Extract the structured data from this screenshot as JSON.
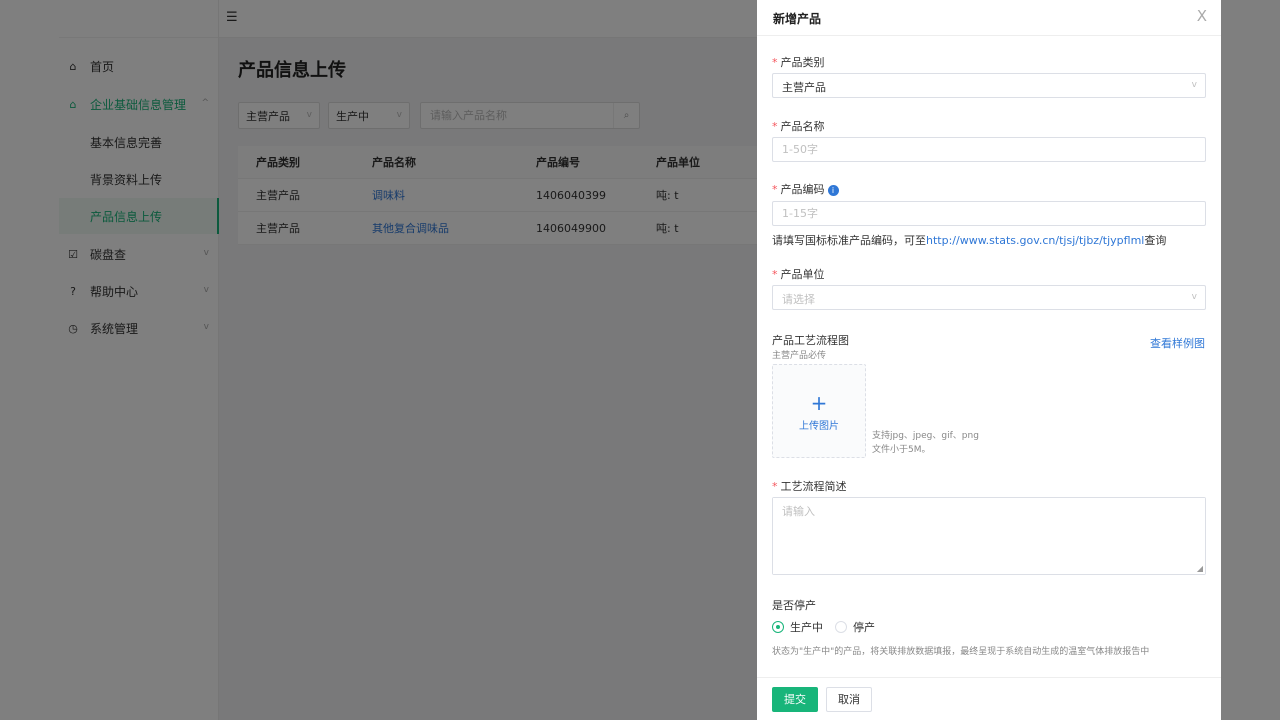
{
  "sidebar": {
    "items": [
      {
        "label": "首页",
        "icon": "home-icon"
      },
      {
        "label": "企业基础信息管理",
        "icon": "building-icon"
      },
      {
        "label": "碳盘查",
        "icon": "checklist-icon"
      },
      {
        "label": "帮助中心",
        "icon": "help-icon"
      },
      {
        "label": "系统管理",
        "icon": "settings-icon"
      }
    ],
    "subitems": [
      {
        "label": "基本信息完善"
      },
      {
        "label": "背景资料上传"
      },
      {
        "label": "产品信息上传"
      }
    ]
  },
  "page": {
    "title": "产品信息上传",
    "filters": {
      "category": "主营产品",
      "status": "生产中",
      "search_placeholder": "请输入产品名称"
    },
    "table": {
      "columns": [
        "产品类别",
        "产品名称",
        "产品编号",
        "产品单位"
      ],
      "rows": [
        [
          "主营产品",
          "调味料",
          "1406040399",
          "吨: t"
        ],
        [
          "主营产品",
          "其他复合调味品",
          "1406049900",
          "吨: t"
        ]
      ]
    }
  },
  "drawer": {
    "title": "新增产品",
    "close": "X",
    "category": {
      "label": "产品类别",
      "value": "主营产品"
    },
    "name": {
      "label": "产品名称",
      "placeholder": "1-50字"
    },
    "code": {
      "label": "产品编码",
      "placeholder": "1-15字",
      "hint_prefix": "请填写国标标准产品编码，可至",
      "hint_link": "http://www.stats.gov.cn/tjsj/tjbz/tjypflml",
      "hint_suffix": "查询"
    },
    "unit": {
      "label": "产品单位",
      "placeholder": "请选择"
    },
    "flowchart": {
      "label": "产品工艺流程图",
      "sub": "主营产品必传",
      "example_link": "查看样例图",
      "upload_label": "上传图片",
      "hint1": "支持jpg、jpeg、gif、png",
      "hint2": "文件小于5M。"
    },
    "process": {
      "label": "工艺流程简述",
      "placeholder": "请输入"
    },
    "stopped": {
      "label": "是否停产",
      "options": [
        "生产中",
        "停产"
      ],
      "selected": "生产中",
      "hint": "状态为\"生产中\"的产品，将关联排放数据填报，最终呈现于系统自动生成的温室气体排放报告中"
    },
    "submit": "提交",
    "cancel": "取消"
  },
  "colors": {
    "accent": "#18b57a",
    "link": "#2f77d6",
    "required": "#f5555b"
  }
}
